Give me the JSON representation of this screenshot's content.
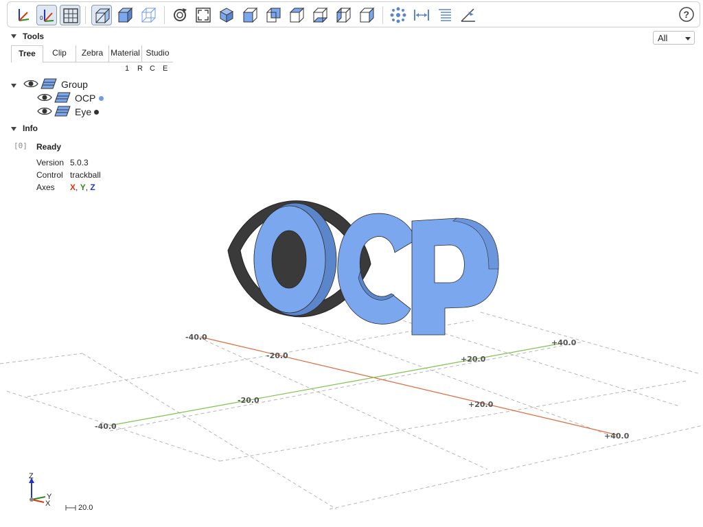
{
  "toolbar": {
    "buttons": [
      {
        "icon": "axes-icon"
      },
      {
        "icon": "axes-origin-icon",
        "active": true
      },
      {
        "icon": "grid-icon",
        "active": true
      },
      {
        "icon": "transparent-icon",
        "active": true
      },
      {
        "icon": "black-edges-icon"
      },
      {
        "icon": "wireframe-icon"
      },
      {
        "icon": "reset-view-icon"
      },
      {
        "icon": "resize-icon"
      },
      {
        "icon": "iso-view-icon"
      },
      {
        "icon": "front-view-icon"
      },
      {
        "icon": "rear-view-icon"
      },
      {
        "icon": "top-view-icon"
      },
      {
        "icon": "bottom-view-icon"
      },
      {
        "icon": "left-view-icon"
      },
      {
        "icon": "right-view-icon"
      },
      {
        "icon": "explode-icon"
      },
      {
        "icon": "distance-icon"
      },
      {
        "icon": "properties-icon"
      },
      {
        "icon": "angle-icon"
      }
    ],
    "help_icon": "help-icon"
  },
  "filter": {
    "selected": "All"
  },
  "tools": {
    "title": "Tools",
    "tabs": [
      {
        "label": "Tree",
        "active": true
      },
      {
        "label": "Clip"
      },
      {
        "label": "Zebra"
      },
      {
        "label": "Material"
      },
      {
        "label": "Studio"
      }
    ],
    "columns": [
      "1",
      "R",
      "C",
      "E"
    ]
  },
  "tree": {
    "root": {
      "label": "Group"
    },
    "children": [
      {
        "label": "OCP",
        "color": "#6f9ce8"
      },
      {
        "label": "Eye",
        "color": "#333333"
      }
    ]
  },
  "info": {
    "title": "Info",
    "index": "[0]",
    "status": "Ready",
    "rows": [
      {
        "key": "Version",
        "value": "5.0.3"
      },
      {
        "key": "Control",
        "value": "trackball"
      }
    ],
    "axes_key": "Axes",
    "axes": {
      "x": "X",
      "y": "Y",
      "z": "Z",
      "sep1": ", ",
      "sep2": ", "
    },
    "axis_colors": {
      "x": "#d9360a",
      "y": "#2f8a1c",
      "z": "#2233cc"
    }
  },
  "viewport": {
    "grid_labels": {
      "x_neg40": "-40.0",
      "x_neg20": "-20.0",
      "x_pos20": "+20.0",
      "x_pos40": "+40.0",
      "y_neg40": "-40.0",
      "y_neg20": "-20.0",
      "y_pos20": "+20.0",
      "y_pos40": "+40.0"
    },
    "scale": "20.0",
    "mini_axes": {
      "z": "Z",
      "y": "Y",
      "x": "X"
    },
    "model_color": "#7ba7ee",
    "eye_color": "#333333"
  }
}
